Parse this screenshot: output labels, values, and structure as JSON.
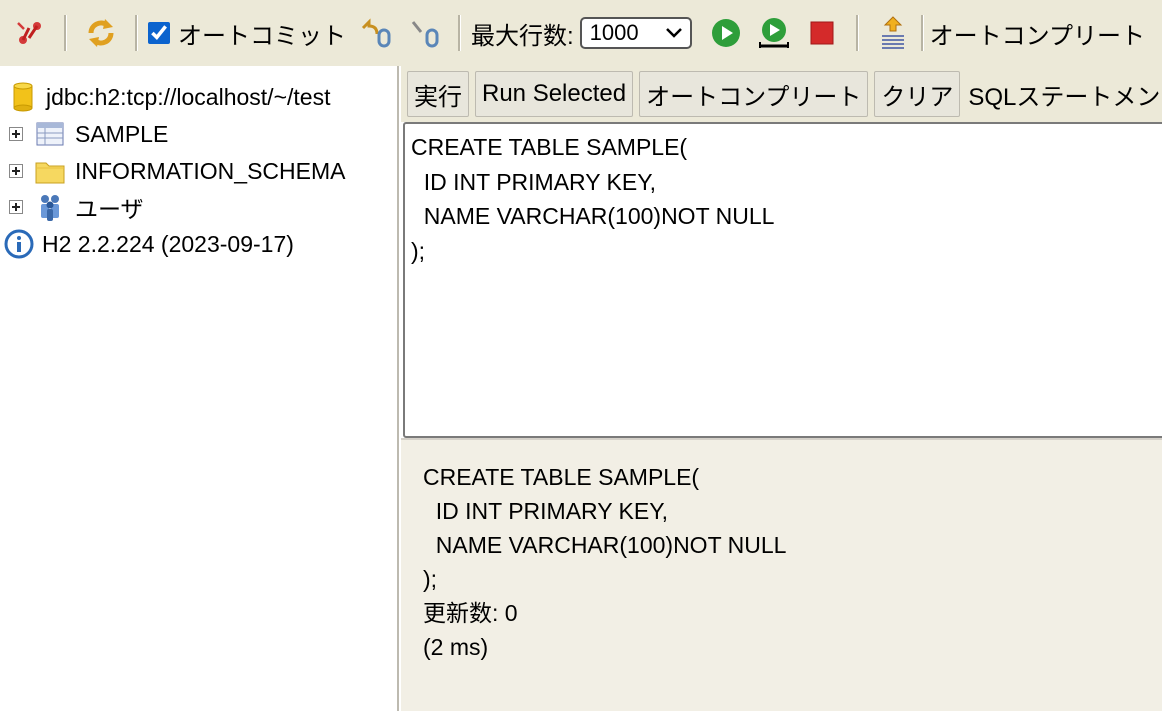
{
  "toolbar": {
    "autocommit_label": "オートコミット",
    "autocommit_checked": true,
    "max_rows_label": "最大行数:",
    "max_rows_value": "1000",
    "autocomplete_label": "オートコンプリート"
  },
  "tree": {
    "connection": "jdbc:h2:tcp://localhost/~/test",
    "items": [
      {
        "label": "SAMPLE",
        "icon": "table-icon"
      },
      {
        "label": "INFORMATION_SCHEMA",
        "icon": "folder-icon"
      },
      {
        "label": "ユーザ",
        "icon": "users-icon"
      }
    ],
    "version": "H2 2.2.224 (2023-09-17)"
  },
  "buttons": {
    "run": "実行",
    "run_selected": "Run Selected",
    "autocomplete": "オートコンプリート",
    "clear": "クリア",
    "sql_statement_label": "SQLステートメン"
  },
  "editor": {
    "sql": "CREATE TABLE SAMPLE(\n  ID INT PRIMARY KEY,\n  NAME VARCHAR(100)NOT NULL\n);"
  },
  "result": {
    "sql": "CREATE TABLE SAMPLE(\n  ID INT PRIMARY KEY,\n  NAME VARCHAR(100)NOT NULL\n);",
    "update_count": "更新数: 0",
    "time": "(2 ms)"
  }
}
